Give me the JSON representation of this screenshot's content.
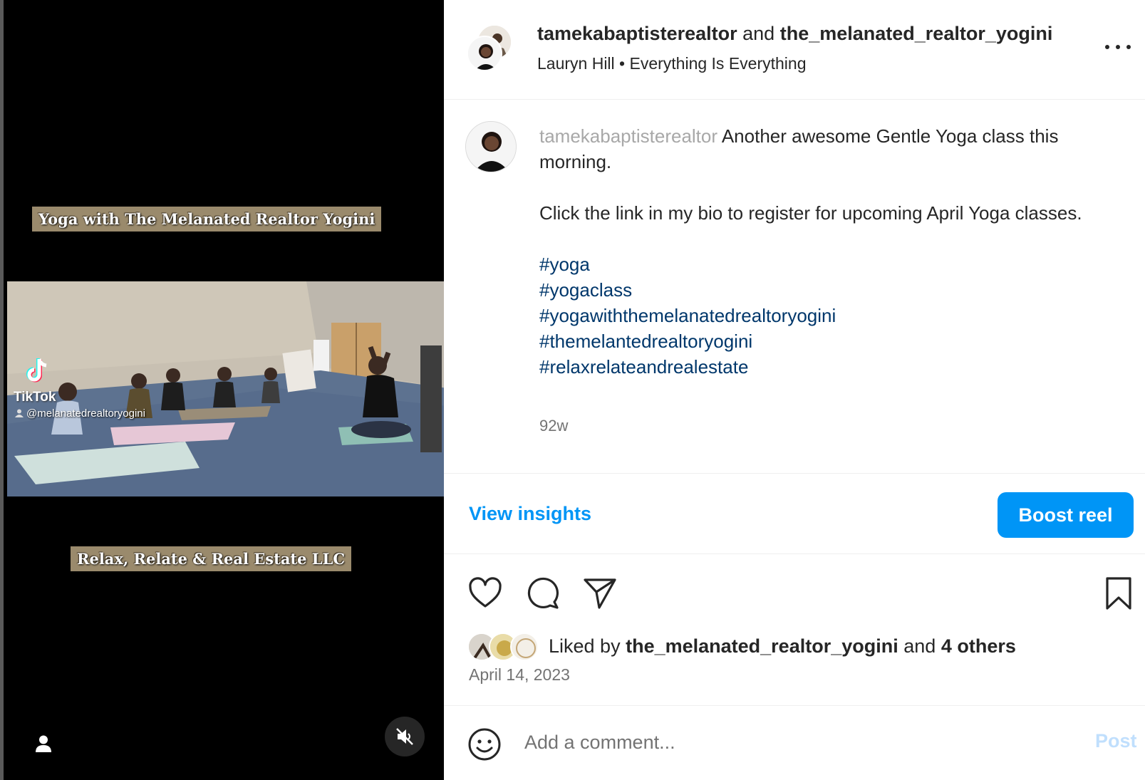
{
  "media": {
    "banner_top": "Yoga with The Melanated Realtor Yogini",
    "banner_bottom": "Relax, Relate & Real Estate LLC",
    "watermark_brand": "TikTok",
    "watermark_handle": "@melanatedrealtoryogini",
    "icons": {
      "tag": "person-icon",
      "mute": "muted-speaker-icon",
      "logo": "tiktok-logo-icon"
    }
  },
  "header": {
    "author": "tamekabaptisterealtor",
    "connector": "and",
    "collaborator": "the_melanated_realtor_yogini",
    "audio": "Lauryn Hill • Everything Is Everything",
    "more_icon": "more-options-icon"
  },
  "caption": {
    "username": "tamekabaptisterealtor",
    "line1": "Another awesome Gentle Yoga class this morning.",
    "line2": "Click the link in my bio to register for upcoming April Yoga classes.",
    "hashtags": [
      "#yoga",
      "#yogaclass",
      "#yogawiththemelanatedrealtoryogini",
      "#themelantedrealtoryogini",
      "#relaxrelateandrealestate"
    ],
    "time_ago": "92w"
  },
  "insights": {
    "view_label": "View insights",
    "boost_label": "Boost reel",
    "accent": "#0095f6"
  },
  "actions": {
    "icons": [
      "heart-icon",
      "comment-icon",
      "share-icon",
      "bookmark-icon"
    ]
  },
  "likes": {
    "prefix": "Liked by",
    "user": "the_melanated_realtor_yogini",
    "connector": "and",
    "others": "4 others",
    "date": "April 14, 2023"
  },
  "comment": {
    "placeholder": "Add a comment...",
    "post_label": "Post"
  }
}
